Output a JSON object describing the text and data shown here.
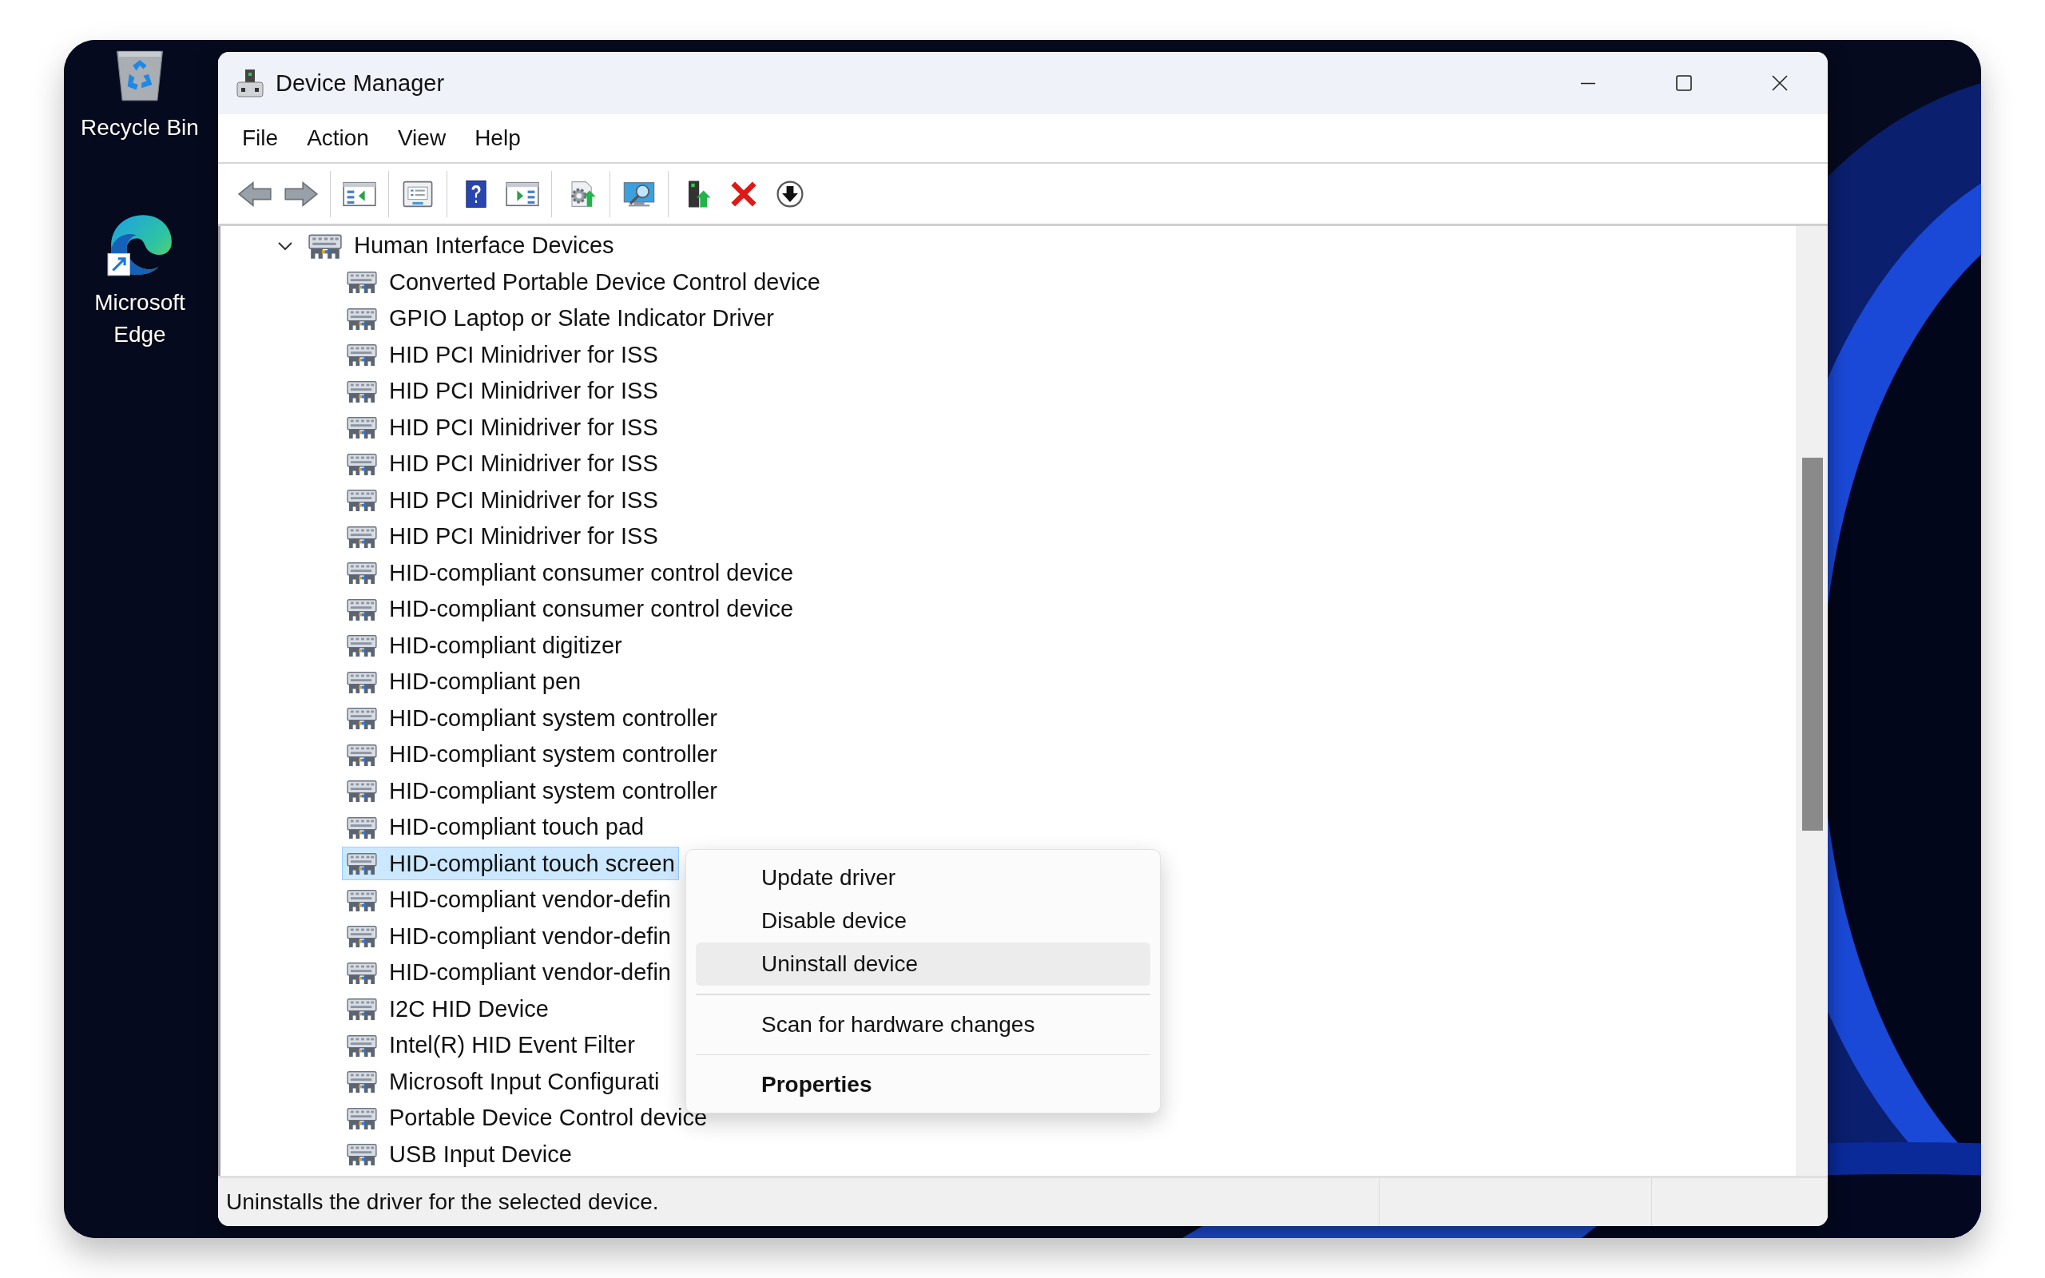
{
  "desktop_icons": [
    {
      "label": "Recycle Bin",
      "kind": "recycle"
    },
    {
      "label": "Microsoft Edge",
      "kind": "edge"
    }
  ],
  "window": {
    "title": "Device Manager"
  },
  "menu": [
    "File",
    "Action",
    "View",
    "Help"
  ],
  "toolbar": [
    [
      {
        "kind": "back"
      },
      {
        "kind": "forward"
      }
    ],
    [
      {
        "kind": "console"
      }
    ],
    [
      {
        "kind": "properties"
      }
    ],
    [
      {
        "kind": "help"
      },
      {
        "kind": "pane"
      }
    ],
    [
      {
        "kind": "update"
      }
    ],
    [
      {
        "kind": "scan"
      }
    ],
    [
      {
        "kind": "enable"
      },
      {
        "kind": "uninstall"
      },
      {
        "kind": "disable"
      }
    ]
  ],
  "tree": {
    "label": "Human Interface Devices",
    "expanded": true,
    "selected": false,
    "children": [
      {
        "label": "Converted Portable Device Control device",
        "selected": false
      },
      {
        "label": "GPIO Laptop or Slate Indicator Driver",
        "selected": false
      },
      {
        "label": "HID PCI Minidriver for ISS",
        "selected": false
      },
      {
        "label": "HID PCI Minidriver for ISS",
        "selected": false
      },
      {
        "label": "HID PCI Minidriver for ISS",
        "selected": false
      },
      {
        "label": "HID PCI Minidriver for ISS",
        "selected": false
      },
      {
        "label": "HID PCI Minidriver for ISS",
        "selected": false
      },
      {
        "label": "HID PCI Minidriver for ISS",
        "selected": false
      },
      {
        "label": "HID-compliant consumer control device",
        "selected": false
      },
      {
        "label": "HID-compliant consumer control device",
        "selected": false
      },
      {
        "label": "HID-compliant digitizer",
        "selected": false
      },
      {
        "label": "HID-compliant pen",
        "selected": false
      },
      {
        "label": "HID-compliant system controller",
        "selected": false
      },
      {
        "label": "HID-compliant system controller",
        "selected": false
      },
      {
        "label": "HID-compliant system controller",
        "selected": false
      },
      {
        "label": "HID-compliant touch pad",
        "selected": false
      },
      {
        "label": "HID-compliant touch screen",
        "selected": true
      },
      {
        "label": "HID-compliant vendor-defin",
        "selected": false
      },
      {
        "label": "HID-compliant vendor-defin",
        "selected": false
      },
      {
        "label": "HID-compliant vendor-defin",
        "selected": false
      },
      {
        "label": "I2C HID Device",
        "selected": false
      },
      {
        "label": "Intel(R) HID Event Filter",
        "selected": false
      },
      {
        "label": "Microsoft Input Configurati",
        "selected": false
      },
      {
        "label": "Portable Device Control device",
        "selected": false
      },
      {
        "label": "USB Input Device",
        "selected": false
      }
    ]
  },
  "context_menu": [
    {
      "kind": "item",
      "label": "Update driver",
      "highlighted": false
    },
    {
      "kind": "item",
      "label": "Disable device",
      "highlighted": false
    },
    {
      "kind": "item",
      "label": "Uninstall device",
      "highlighted": true
    },
    {
      "kind": "separator"
    },
    {
      "kind": "item",
      "label": "Scan for hardware changes",
      "highlighted": false
    },
    {
      "kind": "separator"
    },
    {
      "kind": "default",
      "label": "Properties",
      "highlighted": false
    }
  ],
  "status_bar": {
    "text": "Uninstalls the driver for the selected device."
  }
}
